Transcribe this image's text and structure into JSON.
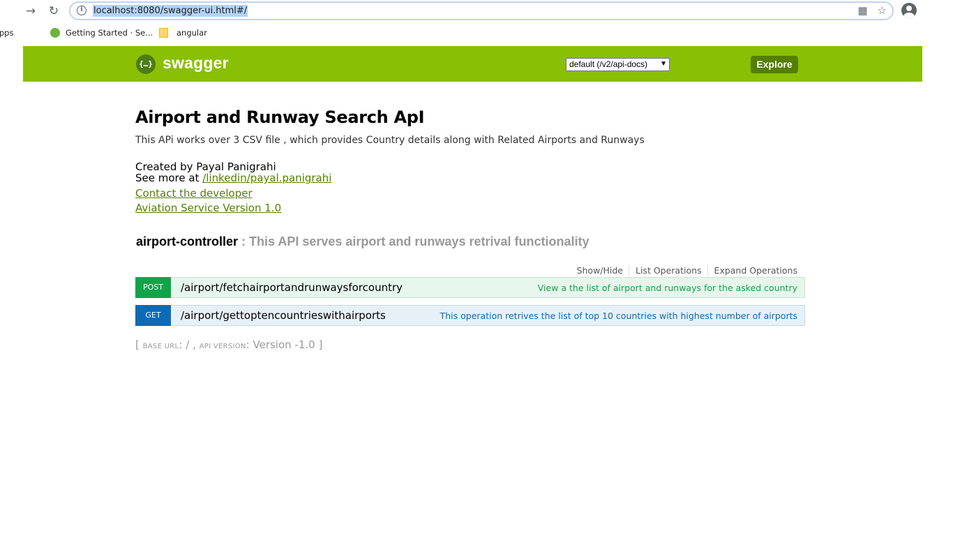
{
  "browser": {
    "url": "localhost:8080/swagger-ui.html#/",
    "bookmarks": [
      {
        "label": "Apps"
      },
      {
        "label": "Getting Started · Se..."
      },
      {
        "label": "angular"
      }
    ]
  },
  "header": {
    "logo_symbol": "{…}",
    "logo_text": "swagger",
    "spec_select": "default (/v2/api-docs)",
    "explore_label": "Explore",
    "brand_color": "#89bf04"
  },
  "info": {
    "title": "Airport and Runway Search ApI",
    "description": "This APi works over 3 CSV file , which provides Country details along with Related Airports and Runways",
    "created_by": "Created by Payal Panigrahi",
    "see_more_prefix": "See more at ",
    "see_more_link": "/linkedin/payal.panigrahi",
    "contact_link": "Contact the developer",
    "version_link": "Aviation Service Version 1.0"
  },
  "controller": {
    "name": "airport-controller",
    "description": " : This API serves airport and runways retrival functionality",
    "actions": {
      "show_hide": "Show/Hide",
      "list_operations": "List Operations",
      "expand_operations": "Expand Operations"
    },
    "operations": [
      {
        "method": "post",
        "path": "/airport/fetchairportandrunwaysforcountry",
        "summary": "View a the list of airport and runways for the asked country",
        "color": "#10a54a"
      },
      {
        "method": "get",
        "path": "/airport/gettoptencountrieswithairports",
        "summary": "This operation retrives the list of top 10 countries with highest number of airports",
        "color": "#0f6ab4"
      }
    ]
  },
  "footer": {
    "open": "[ ",
    "base_url_label": "base url",
    "base_url_value": ": / , ",
    "api_version_label": "api version",
    "api_version_value": ": Version -1.0 ]"
  }
}
